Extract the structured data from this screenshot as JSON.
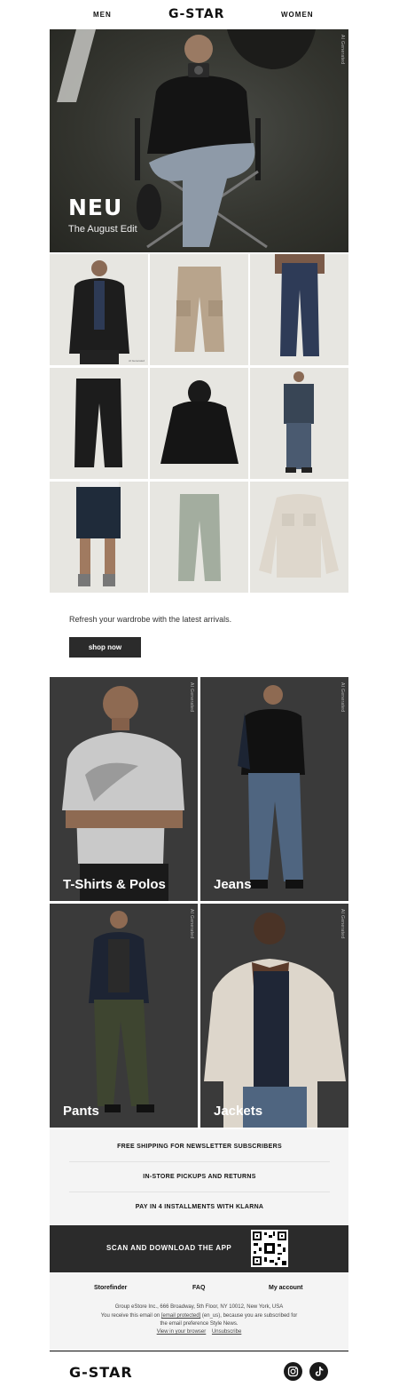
{
  "header": {
    "left_link": "MEN",
    "logo": "G-STAR",
    "right_link": "WOMEN"
  },
  "hero": {
    "title": "NEU",
    "subtitle": "The August Edit",
    "badge": "AI Generated"
  },
  "products": [
    {
      "name": "leather-jacket",
      "badge": "AI Generated"
    },
    {
      "name": "cargo-pants"
    },
    {
      "name": "straight-jeans"
    },
    {
      "name": "pleated-trousers"
    },
    {
      "name": "hooded-jacket"
    },
    {
      "name": "denim-jacket-outfit"
    },
    {
      "name": "denim-shorts"
    },
    {
      "name": "chino-pants"
    },
    {
      "name": "overshirt"
    }
  ],
  "promo": {
    "text": "Refresh your wardrobe with the latest arrivals.",
    "button": "shop now"
  },
  "categories": [
    {
      "label": "T-Shirts & Polos",
      "badge": "AI Generated"
    },
    {
      "label": "Jeans",
      "badge": "AI Generated"
    },
    {
      "label": "Pants",
      "badge": "AI Generated"
    },
    {
      "label": "Jackets",
      "badge": "AI Generated"
    }
  ],
  "perks": [
    "FREE SHIPPING FOR NEWSLETTER SUBSCRIBERS",
    "IN-STORE PICKUPS AND RETURNS",
    "PAY IN 4 INSTALLMENTS WITH KLARNA"
  ],
  "app": {
    "text": "SCAN AND DOWNLOAD THE APP"
  },
  "footer": {
    "links": [
      "Storefinder",
      "FAQ",
      "My account"
    ],
    "address": "Group eStore Inc., 666 Broadway, 5th Floor, NY 10012, New York, USA",
    "notice_1": "You receive this email on",
    "email": "[email protected]",
    "notice_2": "(en_us), because you are subscribed for",
    "notice_3": "the email preference Style News.",
    "view_browser": "View in your browser",
    "unsubscribe": "Unsubscribe",
    "logo": "G-STAR"
  },
  "colors": {
    "dark": "#2b2b2b",
    "grey_bg": "#f4f4f4",
    "tile": "#e7e6e1"
  }
}
